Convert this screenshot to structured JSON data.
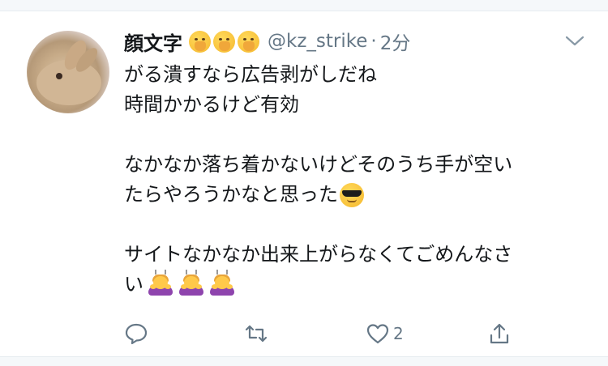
{
  "tweet": {
    "author_name": "顔文字",
    "name_emojis": [
      "face-with-hand-over-mouth",
      "face-with-hand-over-mouth",
      "face-with-hand-over-mouth"
    ],
    "handle": "@kz_strike",
    "separator": "·",
    "time": "2分",
    "lines": [
      "がる潰すなら広告剥がしだね",
      "時間かかるけど有効",
      "",
      "なかなか落ち着かないけどそのうち手が空い",
      "たらやろうかなと思った",
      "",
      "サイトなかなか出来上がらなくてごめんなさ",
      "い"
    ],
    "line5_emoji": "smiling-face-with-sunglasses",
    "line8_emojis": [
      "person-bowing",
      "person-bowing",
      "person-bowing"
    ],
    "like_count": "2"
  },
  "colors": {
    "text": "#14171a",
    "muted": "#657786",
    "divider": "#e6ecf0"
  }
}
